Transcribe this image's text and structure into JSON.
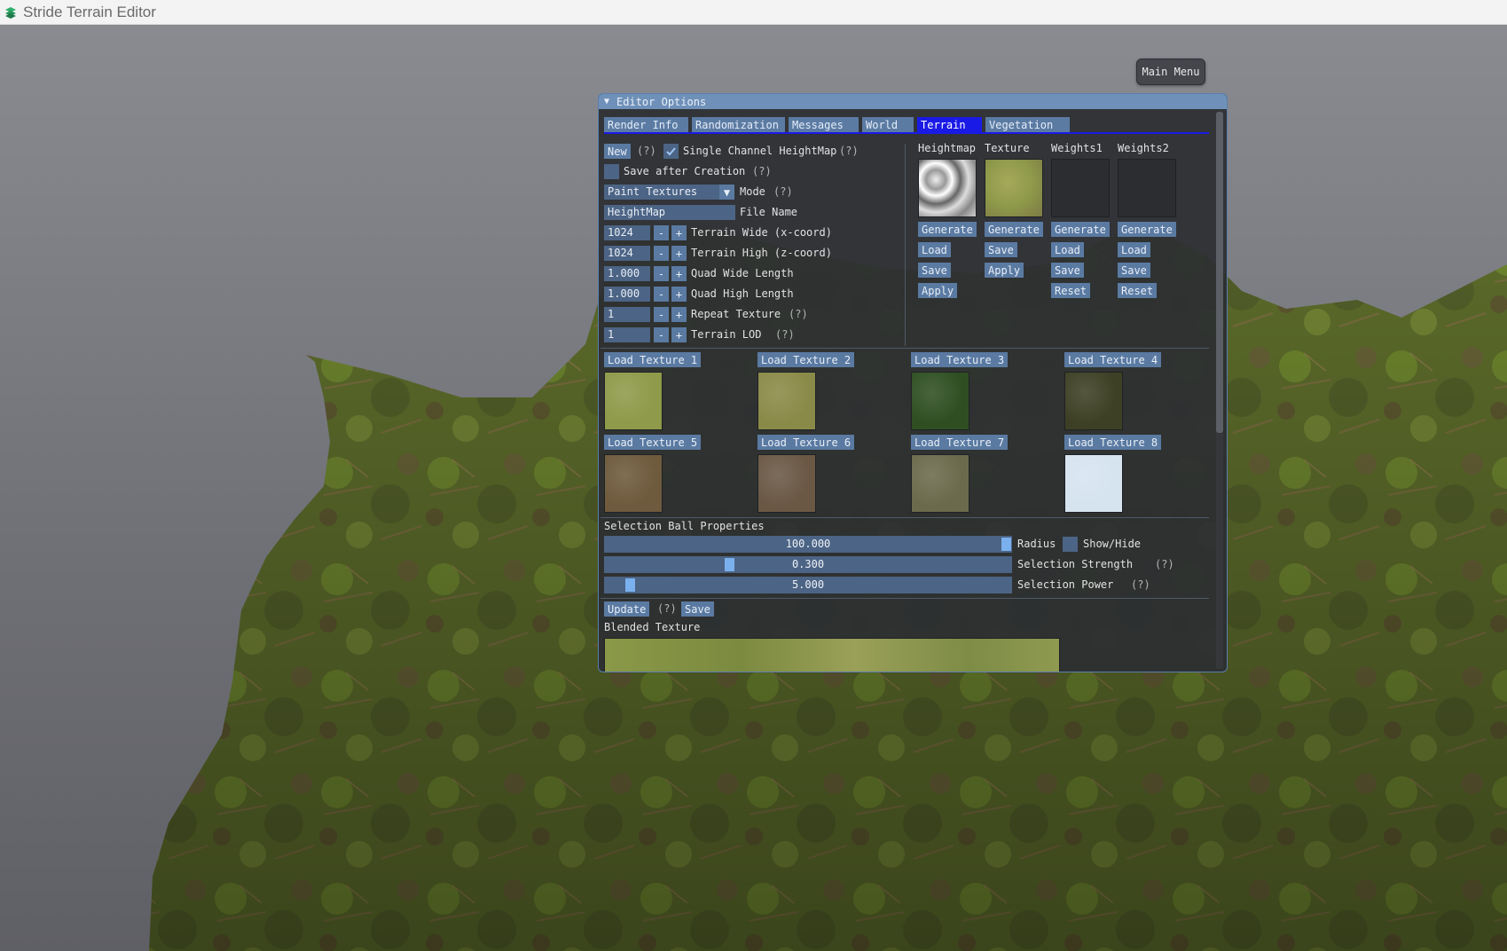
{
  "app": {
    "title": "Stride Terrain Editor",
    "icon": "stride-logo-icon"
  },
  "main_menu": {
    "label": "Main Menu"
  },
  "window": {
    "title": "Editor Options"
  },
  "tabs": [
    {
      "label": "Render Info",
      "active": false
    },
    {
      "label": "Randomization",
      "active": false
    },
    {
      "label": "Messages",
      "active": false
    },
    {
      "label": "World",
      "active": false
    },
    {
      "label": "Terrain",
      "active": true
    },
    {
      "label": "Vegetation",
      "active": false
    }
  ],
  "left_panel": {
    "new_button": "New",
    "help": "(?)",
    "single_channel": {
      "label": "Single Channel HeightMap",
      "checked": true
    },
    "save_after": {
      "label": "Save after Creation",
      "checked": false
    },
    "mode": {
      "value": "Paint Textures",
      "label": "Mode"
    },
    "file_name": {
      "value": "HeightMap",
      "label": "File Name"
    },
    "minus": "-",
    "plus": "+",
    "fields": [
      {
        "value": "1024",
        "label": "Terrain Wide (x-coord)",
        "help": ""
      },
      {
        "value": "1024",
        "label": "Terrain High (z-coord)",
        "help": ""
      },
      {
        "value": "1.000",
        "label": "Quad Wide Length",
        "help": ""
      },
      {
        "value": "1.000",
        "label": "Quad High Length",
        "help": ""
      },
      {
        "value": "1",
        "label": "Repeat Texture",
        "help": "(?)"
      },
      {
        "value": "1",
        "label": "Terrain LOD",
        "help": "(?)"
      }
    ]
  },
  "maps": [
    {
      "title": "Heightmap",
      "buttons": [
        "Generate",
        "Load",
        "Save",
        "Apply"
      ]
    },
    {
      "title": "Texture",
      "buttons": [
        "Generate",
        "Save",
        "Apply"
      ]
    },
    {
      "title": "Weights1",
      "buttons": [
        "Generate",
        "Load",
        "Save",
        "Reset"
      ]
    },
    {
      "title": "Weights2",
      "buttons": [
        "Generate",
        "Load",
        "Save",
        "Reset"
      ]
    }
  ],
  "textures": [
    {
      "label": "Load Texture 1",
      "color": "#8f9a4a"
    },
    {
      "label": "Load Texture 2",
      "color": "#8a8a48"
    },
    {
      "label": "Load Texture 3",
      "color": "#2f4f22"
    },
    {
      "label": "Load Texture 4",
      "color": "#3d4024"
    },
    {
      "label": "Load Texture 5",
      "color": "#6e5a3c"
    },
    {
      "label": "Load Texture 6",
      "color": "#6a5845"
    },
    {
      "label": "Load Texture 7",
      "color": "#6b6a4c"
    },
    {
      "label": "Load Texture 8",
      "color": "#d6e4f0"
    }
  ],
  "selection_ball": {
    "title": "Selection Ball Properties",
    "radius": {
      "value": "100.000",
      "label": "Radius",
      "fraction": 1.0
    },
    "show_hide": {
      "label": "Show/Hide",
      "checked": false
    },
    "strength": {
      "value": "0.300",
      "label": "Selection Strength",
      "help": "(?)",
      "fraction": 0.3
    },
    "power": {
      "value": "5.000",
      "label": "Selection Power",
      "help": "(?)",
      "fraction": 0.05
    }
  },
  "blended": {
    "update": "Update",
    "help": "(?)",
    "save": "Save",
    "title": "Blended Texture"
  },
  "colors": {
    "accent": "#1a1ae6",
    "button": "#5a7aa2",
    "title_bar": "#6f90b8"
  }
}
